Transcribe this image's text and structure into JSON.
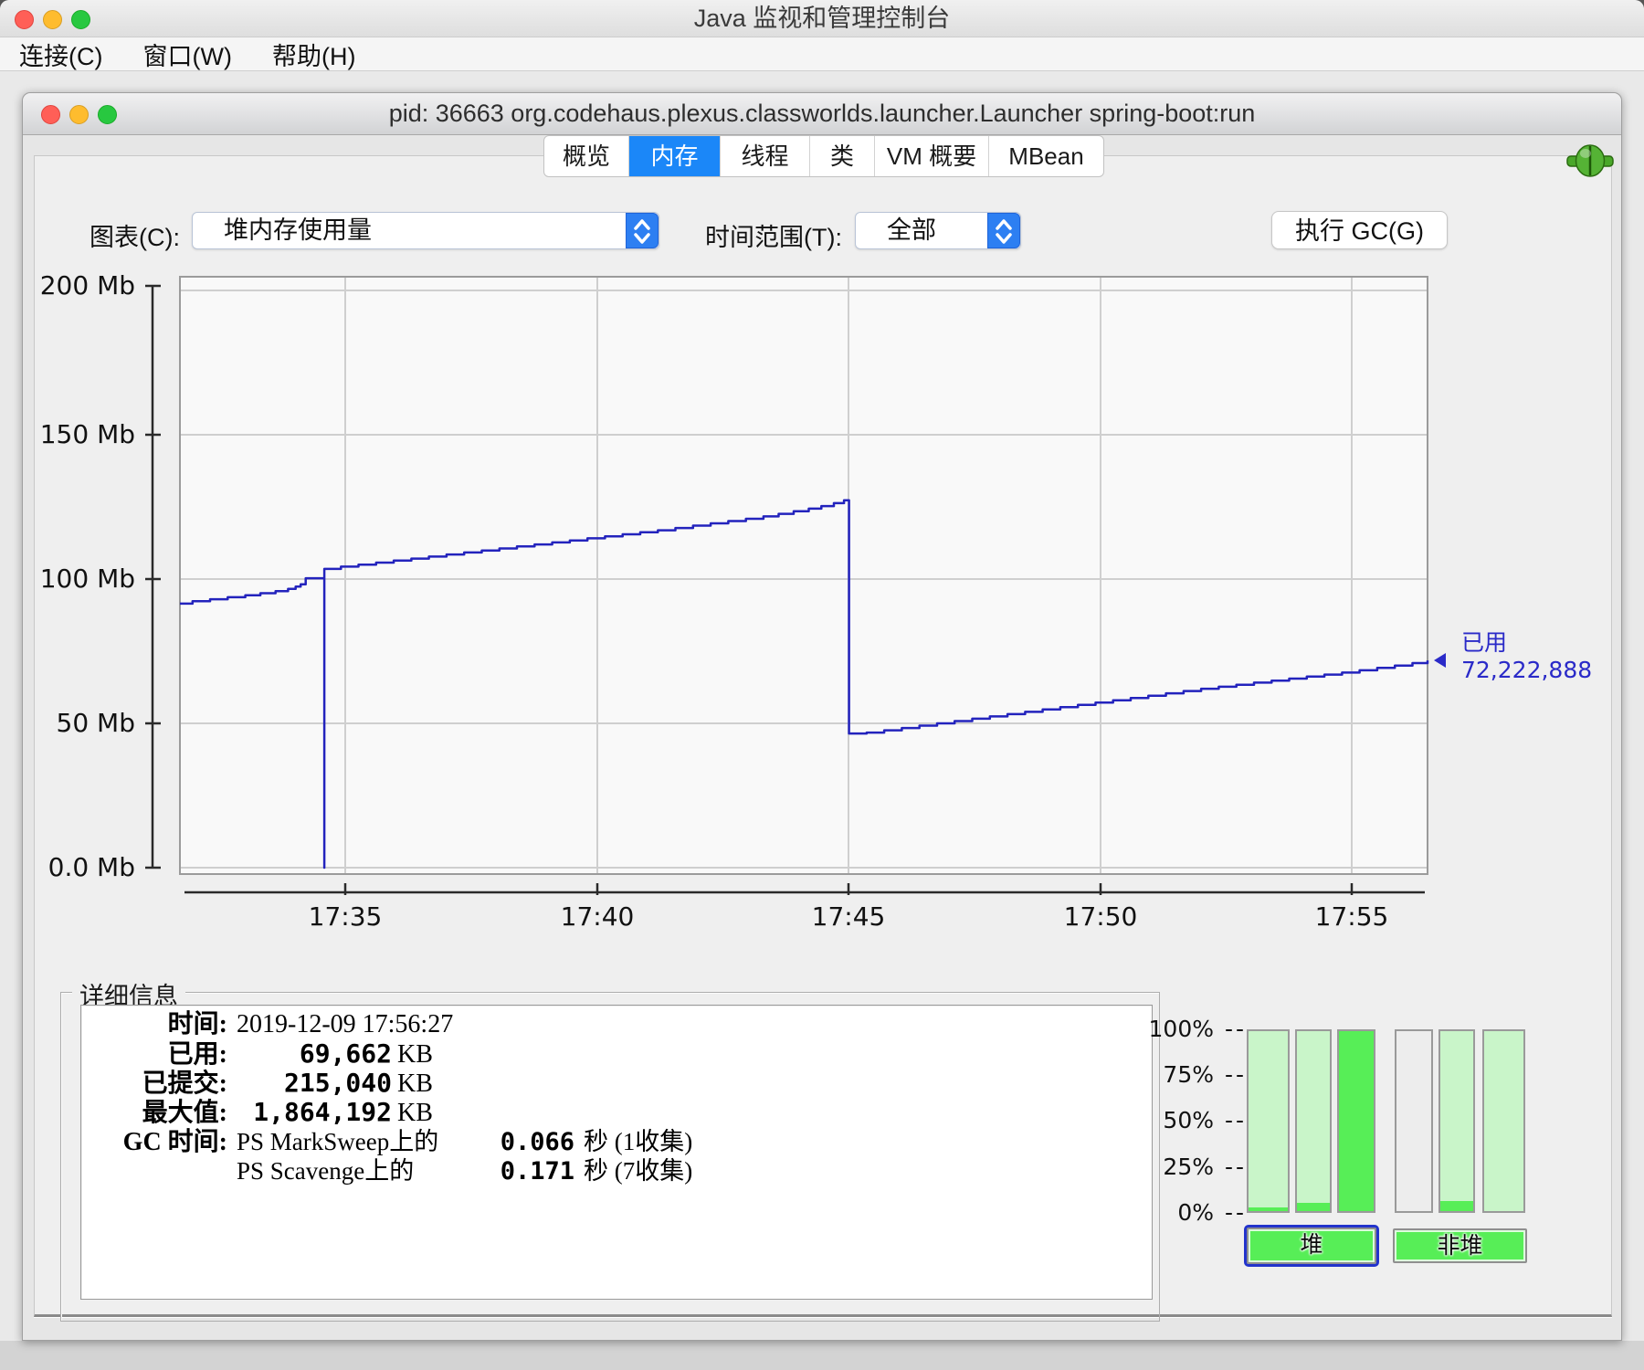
{
  "outer_window": {
    "title": "Java 监视和管理控制台"
  },
  "menu_bar": {
    "items": [
      {
        "label": "连接(C)"
      },
      {
        "label": "窗口(W)"
      },
      {
        "label": "帮助(H)"
      }
    ]
  },
  "inner_window": {
    "title": "pid: 36663 org.codehaus.plexus.classworlds.launcher.Launcher spring-boot:run"
  },
  "tab_bar": {
    "selected_color": "#1b87f8",
    "tabs": [
      {
        "label": "概览",
        "selected": false
      },
      {
        "label": "内存",
        "selected": true
      },
      {
        "label": "线程",
        "selected": false
      },
      {
        "label": "类",
        "selected": false
      },
      {
        "label": "VM 概要",
        "selected": false
      },
      {
        "label": "MBean",
        "selected": false
      }
    ]
  },
  "controls": {
    "chart_label": "图表(C):",
    "chart_select": {
      "value": "堆内存使用量"
    },
    "range_label": "时间范围(T):",
    "range_select": {
      "value": "全部"
    },
    "gc_button_label": "执行 GC(G)"
  },
  "chart_data": {
    "type": "line",
    "title": "堆内存使用量",
    "ylabel": "Mb",
    "ylim": [
      0,
      200
    ],
    "y_ticks": [
      "200 Mb",
      "150 Mb",
      "100 Mb",
      "50 Mb",
      "0.0 Mb"
    ],
    "x_ticks": [
      "17:35",
      "17:40",
      "17:45",
      "17:50",
      "17:55"
    ],
    "x_tick_minutes_after_1730": [
      5,
      10,
      15,
      20,
      25
    ],
    "x_range_minutes_after_1730": [
      1.7,
      26.5
    ],
    "grid": true,
    "line_color": "#2323bd",
    "plot_bg": "#f9f9f9",
    "annotation": {
      "label": "已用",
      "value": "72,222,888",
      "color": "#2a2ac8",
      "at_mb": 71.8
    },
    "events": [
      {
        "t_min": 4.57,
        "type": "momentary-dip-to-zero"
      },
      {
        "t_min": 15.0,
        "type": "gc-drop",
        "from_mb": 127.3,
        "to_mb": 46.5
      }
    ],
    "series": [
      {
        "name": "已用",
        "unit": "Mb",
        "points_t_mb": [
          [
            1.7,
            91.5
          ],
          [
            1.95,
            92.3
          ],
          [
            2.3,
            93.0
          ],
          [
            2.65,
            93.7
          ],
          [
            3.0,
            94.4
          ],
          [
            3.3,
            95.1
          ],
          [
            3.6,
            95.8
          ],
          [
            3.85,
            96.6
          ],
          [
            4.0,
            97.4
          ],
          [
            4.1,
            98.2
          ],
          [
            4.2,
            100.3
          ],
          [
            4.57,
            0
          ],
          [
            4.57,
            103.5
          ],
          [
            4.9,
            104.3
          ],
          [
            5.25,
            105.0
          ],
          [
            5.6,
            105.7
          ],
          [
            5.95,
            106.4
          ],
          [
            6.3,
            107.1
          ],
          [
            6.65,
            107.8
          ],
          [
            7.0,
            108.5
          ],
          [
            7.35,
            109.2
          ],
          [
            7.7,
            109.9
          ],
          [
            8.05,
            110.6
          ],
          [
            8.4,
            111.3
          ],
          [
            8.75,
            112.0
          ],
          [
            9.1,
            112.7
          ],
          [
            9.45,
            113.4
          ],
          [
            9.8,
            114.1
          ],
          [
            10.15,
            114.8
          ],
          [
            10.5,
            115.5
          ],
          [
            10.85,
            116.2
          ],
          [
            11.2,
            116.9
          ],
          [
            11.55,
            117.7
          ],
          [
            11.9,
            118.5
          ],
          [
            12.25,
            119.3
          ],
          [
            12.6,
            120.1
          ],
          [
            12.95,
            120.9
          ],
          [
            13.3,
            121.7
          ],
          [
            13.6,
            122.6
          ],
          [
            13.9,
            123.5
          ],
          [
            14.2,
            124.4
          ],
          [
            14.45,
            125.3
          ],
          [
            14.7,
            126.3
          ],
          [
            14.9,
            127.3
          ],
          [
            15.0,
            46.5
          ],
          [
            15.35,
            46.8
          ],
          [
            15.7,
            47.6
          ],
          [
            16.05,
            48.4
          ],
          [
            16.4,
            49.2
          ],
          [
            16.75,
            50.0
          ],
          [
            17.1,
            50.8
          ],
          [
            17.45,
            51.6
          ],
          [
            17.8,
            52.4
          ],
          [
            18.15,
            53.2
          ],
          [
            18.5,
            54.0
          ],
          [
            18.85,
            54.8
          ],
          [
            19.2,
            55.6
          ],
          [
            19.55,
            56.4
          ],
          [
            19.9,
            57.2
          ],
          [
            20.25,
            58.0
          ],
          [
            20.6,
            58.8
          ],
          [
            20.95,
            59.6
          ],
          [
            21.3,
            60.4
          ],
          [
            21.65,
            61.2
          ],
          [
            22.0,
            62.0
          ],
          [
            22.35,
            62.7
          ],
          [
            22.7,
            63.4
          ],
          [
            23.05,
            64.1
          ],
          [
            23.4,
            64.8
          ],
          [
            23.75,
            65.5
          ],
          [
            24.1,
            66.2
          ],
          [
            24.45,
            66.9
          ],
          [
            24.8,
            67.6
          ],
          [
            25.15,
            68.4
          ],
          [
            25.5,
            69.2
          ],
          [
            25.85,
            70.0
          ],
          [
            26.2,
            70.9
          ],
          [
            26.5,
            71.8
          ]
        ]
      }
    ]
  },
  "details": {
    "legend": "详细信息",
    "rows": [
      {
        "label": "时间:",
        "value": "2019-12-09 17:56:27"
      },
      {
        "label": "已用:",
        "num": "69,662",
        "unit": "KB"
      },
      {
        "label": "已提交:",
        "num": "215,040",
        "unit": "KB"
      },
      {
        "label": "最大值:",
        "num": "1,864,192",
        "unit": "KB"
      }
    ],
    "gc": {
      "label": "GC 时间:",
      "rows": [
        {
          "name": "PS MarkSweep上的",
          "num": "0.066",
          "suffix": "秒 (1收集)"
        },
        {
          "name": "PS Scavenge上的",
          "num": "0.171",
          "suffix": "秒 (7收集)"
        }
      ]
    }
  },
  "gauges": {
    "pct_ticks": [
      "100%",
      "75%",
      "50%",
      "25%",
      "0%"
    ],
    "dash": "--",
    "bars": [
      {
        "group": "heap",
        "bg": "light",
        "fill_pct": 2
      },
      {
        "group": "heap",
        "bg": "light",
        "fill_pct": 4.5
      },
      {
        "group": "heap",
        "bg": "light",
        "fill_pct": 100
      },
      {
        "group": "nonheap",
        "bg": "empty",
        "fill_pct": 0
      },
      {
        "group": "nonheap",
        "bg": "light",
        "fill_pct": 5.5
      },
      {
        "group": "nonheap",
        "bg": "light",
        "fill_pct": 0
      }
    ],
    "heap_button": "堆",
    "nonheap_button": "非堆",
    "colors": {
      "light_green": "#c9f5c9",
      "bright_green": "#57ee57",
      "empty": "#ededed",
      "focus_ring": "#2233cc"
    }
  }
}
